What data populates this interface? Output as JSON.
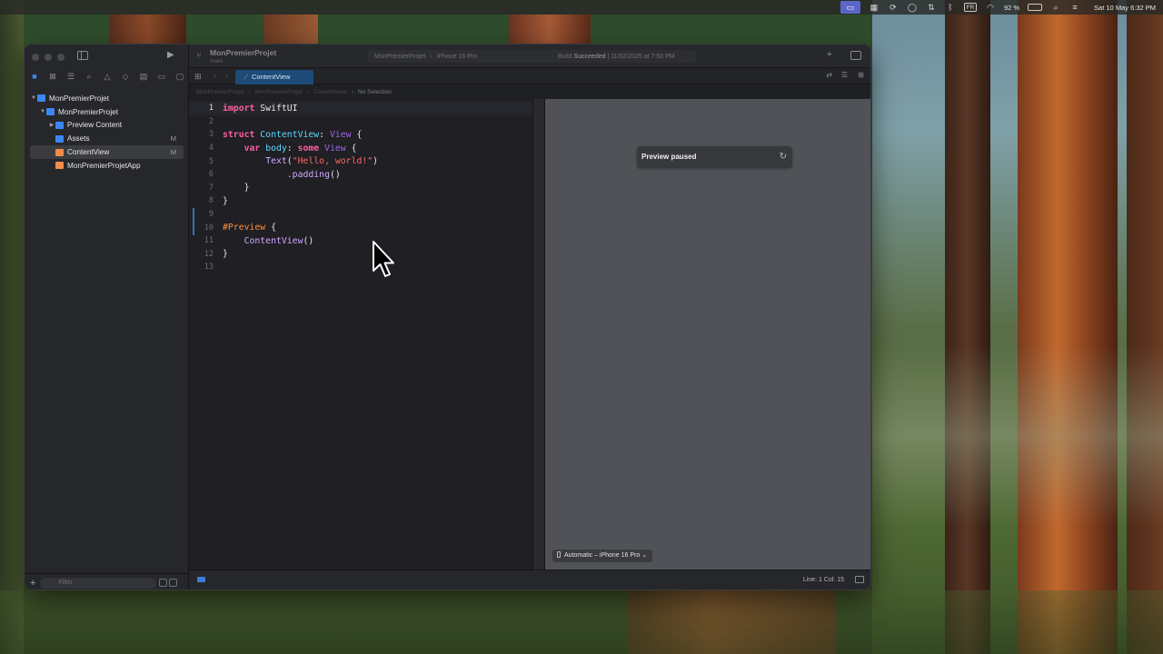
{
  "menubar": {
    "battery": "92 %",
    "keyboard": "FR",
    "datetime": "Sat 10 May  6:32 PM"
  },
  "window": {
    "project_name": "MonPremierProjet",
    "project_sub": "main",
    "scheme": "MonPremierProjet",
    "device": "iPhone 16 Pro",
    "build_status_prefix": "Build",
    "build_status_word": "Succeeded",
    "build_time": "| 11/02/2025 at 7:50 PM"
  },
  "navigator": {
    "items": [
      {
        "label": "MonPremierProjet",
        "badge": "",
        "icon_color": "#3d86f2"
      },
      {
        "label": "MonPremierProjet",
        "badge": "",
        "icon_color": "#3d86f2"
      },
      {
        "label": "Preview Content",
        "badge": "",
        "icon_color": "#3d86f2"
      },
      {
        "label": "Assets",
        "badge": "M",
        "icon_color": "#3d86f2"
      },
      {
        "label": "ContentView",
        "badge": "M",
        "icon_color": "#f08d49"
      },
      {
        "label": "MonPremierProjetApp",
        "badge": "",
        "icon_color": "#f08d49"
      }
    ],
    "filter_placeholder": "Filter"
  },
  "tabs": {
    "active": "ContentView"
  },
  "jumpbar": {
    "crumb1": "MonPremierProjet",
    "crumb2": "MonPremierProjet",
    "crumb3": "ContentView",
    "crumb4": "No Selection"
  },
  "editor": {
    "lines": [
      {
        "n": "1"
      },
      {
        "n": "2"
      },
      {
        "n": "3"
      },
      {
        "n": "4"
      },
      {
        "n": "5"
      },
      {
        "n": "6"
      },
      {
        "n": "7"
      },
      {
        "n": "8"
      },
      {
        "n": "9"
      },
      {
        "n": "10"
      },
      {
        "n": "11"
      },
      {
        "n": "12"
      },
      {
        "n": "13"
      }
    ],
    "code": {
      "l1_kw": "import",
      "l1_rest": " SwiftUI",
      "l3_kw": "struct",
      "l3_name": " ContentView",
      "l3_colon": ": ",
      "l3_type": "View",
      "l3_brace": " {",
      "l4_indent": "    ",
      "l4_kw": "var",
      "l4_name": " body",
      "l4_colon": ": ",
      "l4_some": "some",
      "l4_sp": " ",
      "l4_type": "View",
      "l4_brace": " {",
      "l5_indent": "        ",
      "l5_fn": "Text",
      "l5_open": "(",
      "l5_str": "\"Hello, world!\"",
      "l5_close": ")",
      "l6_indent": "            ",
      "l6_fn": ".padding",
      "l6_paren": "()",
      "l7": "    }",
      "l8": "}",
      "l10_macro": "#Preview",
      "l10_brace": " {",
      "l11_indent": "    ",
      "l11_fn": "ContentView",
      "l11_paren": "()",
      "l12": "}"
    }
  },
  "preview": {
    "status": "Preview paused",
    "device_selector": "Automatic – iPhone 16 Pro ⌄"
  },
  "statusbar": {
    "position": "Line: 1  Col: 15"
  }
}
